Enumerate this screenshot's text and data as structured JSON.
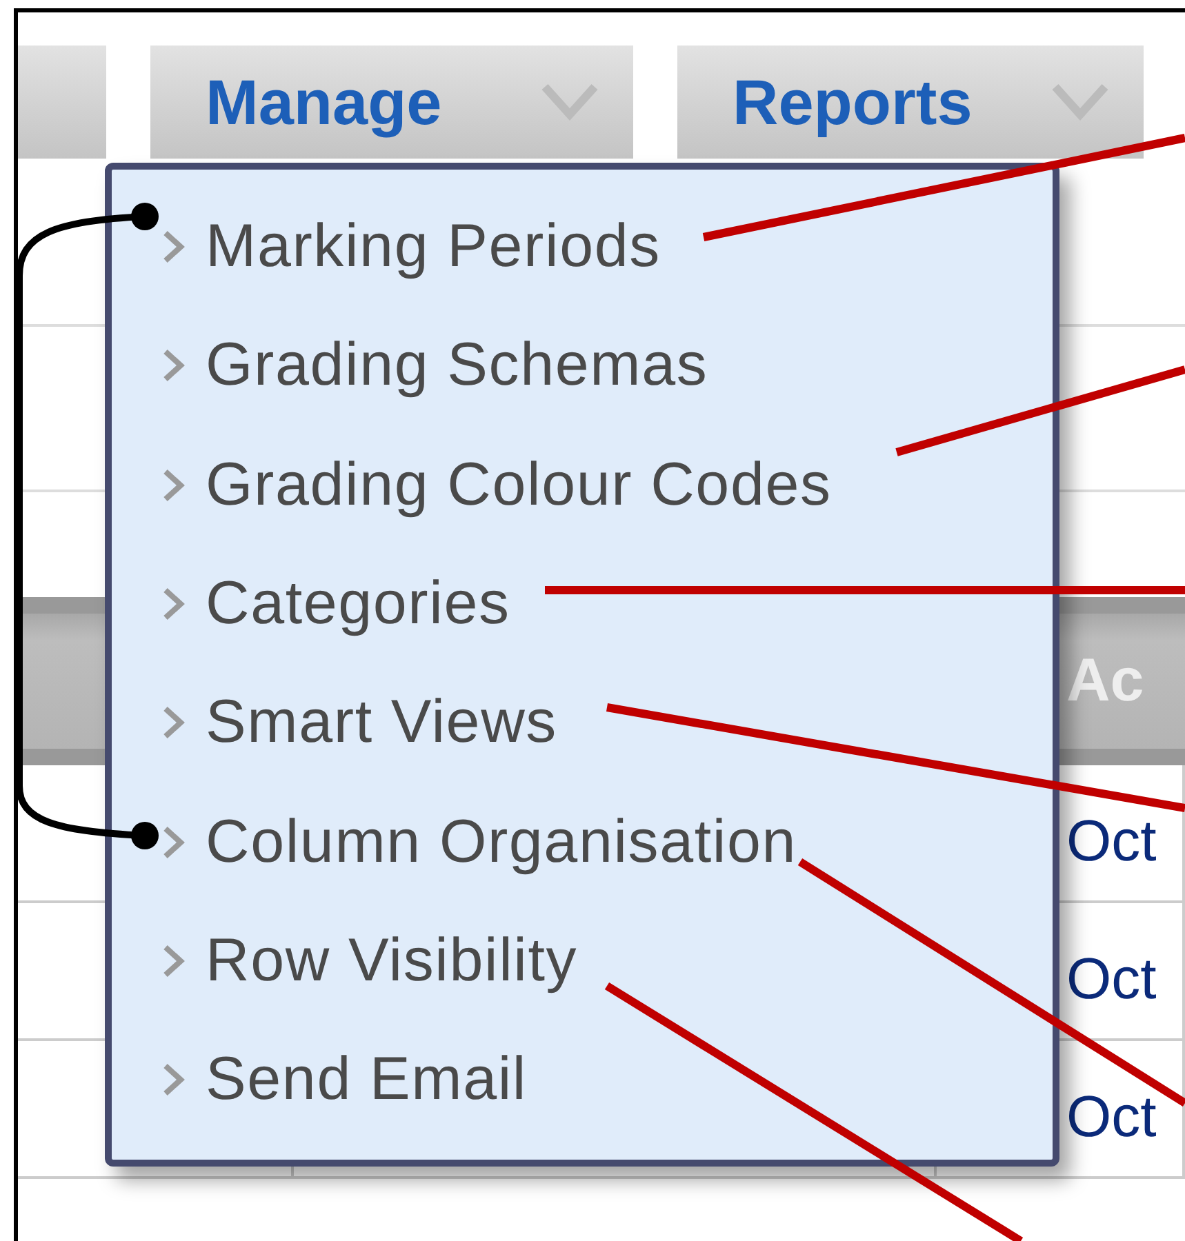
{
  "tabs": [
    {
      "label": "Manage"
    },
    {
      "label": "Reports"
    }
  ],
  "menu": {
    "items": [
      "Marking Periods",
      "Grading Schemas",
      "Grading Colour Codes",
      "Categories",
      "Smart Views",
      "Column Organisation",
      "Row Visibility",
      "Send Email"
    ]
  },
  "table": {
    "header": "Ac",
    "cells": [
      "Oct",
      "Oct",
      "Oct"
    ]
  }
}
